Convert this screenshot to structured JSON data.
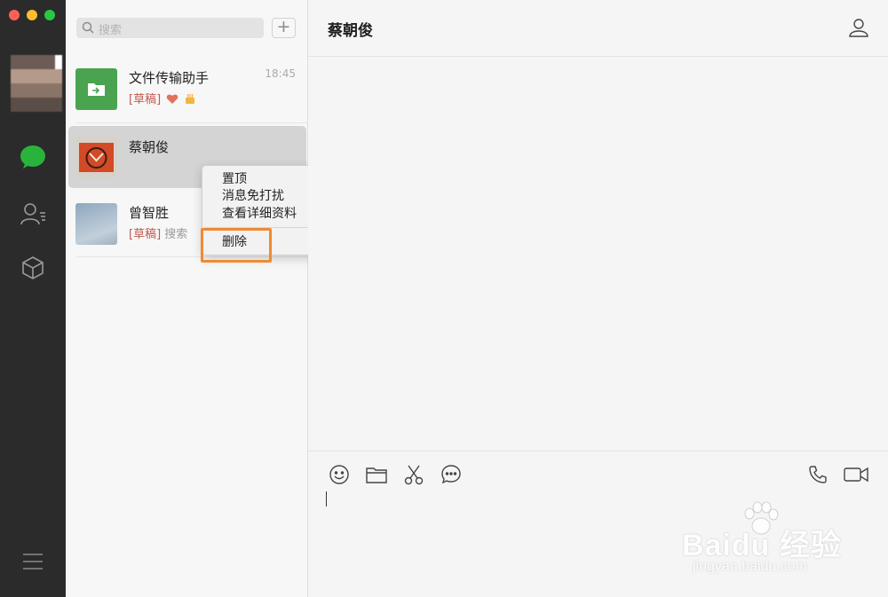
{
  "search": {
    "placeholder": "搜索"
  },
  "add_button": {
    "label": "+"
  },
  "chats": [
    {
      "name": "文件传输助手",
      "draft": "[草稿]",
      "preview": "",
      "time": "18:45"
    },
    {
      "name": "蔡朝俊",
      "draft": "",
      "preview": "",
      "time": ""
    },
    {
      "name": "曾智胜",
      "draft": "[草稿]",
      "preview": "搜索",
      "time": ""
    }
  ],
  "context_menu": {
    "items": [
      "置顶",
      "消息免打扰",
      "查看详细资料"
    ],
    "delete_label": "删除"
  },
  "main": {
    "title": "蔡朝俊"
  },
  "watermark": {
    "brand": "Baidu 经验",
    "url": "jingyan.baidu.com"
  },
  "colors": {
    "accent": "#28b43c",
    "highlight": "#f08a32",
    "draft": "#c2594f"
  }
}
